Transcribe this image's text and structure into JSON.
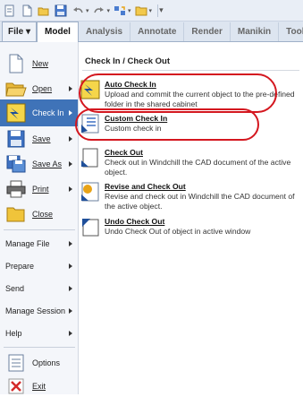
{
  "quick_access_toolbar": {
    "icons": [
      "file-icon",
      "new-icon",
      "open-icon",
      "save-icon",
      "undo-icon",
      "redo-icon",
      "regenerate-icon",
      "folder-icon",
      "more-icon"
    ]
  },
  "ribbon": {
    "file_tab": "File",
    "tabs": [
      "Model",
      "Analysis",
      "Annotate",
      "Render",
      "Manikin",
      "Tools"
    ]
  },
  "file_menu": {
    "items": [
      {
        "label": "New"
      },
      {
        "label": "Open"
      },
      {
        "label": "Check In"
      },
      {
        "label": "Save"
      },
      {
        "label": "Save As"
      },
      {
        "label": "Print"
      },
      {
        "label": "Close"
      },
      {
        "label": "Manage File"
      },
      {
        "label": "Prepare"
      },
      {
        "label": "Send"
      },
      {
        "label": "Manage Session"
      },
      {
        "label": "Help"
      },
      {
        "label": "Options"
      },
      {
        "label": "Exit"
      }
    ]
  },
  "submenu": {
    "title": "Check In / Check Out",
    "entries": [
      {
        "title": "Auto Check In",
        "description": "Upload and commit the current object to the pre-defined folder in the shared cabinet"
      },
      {
        "title": "Custom Check In",
        "description": "Custom check in"
      },
      {
        "title": "Check Out",
        "description": "Check out in Windchill the CAD document of the active object."
      },
      {
        "title": "Revise and Check Out",
        "description": "Revise and check out in Windchill the CAD document of the active object."
      },
      {
        "title": "Undo Check Out",
        "description": "Undo Check Out of object in active window"
      }
    ]
  },
  "colors": {
    "selected_item": "#3f73b8",
    "annotation": "#d4171f"
  }
}
